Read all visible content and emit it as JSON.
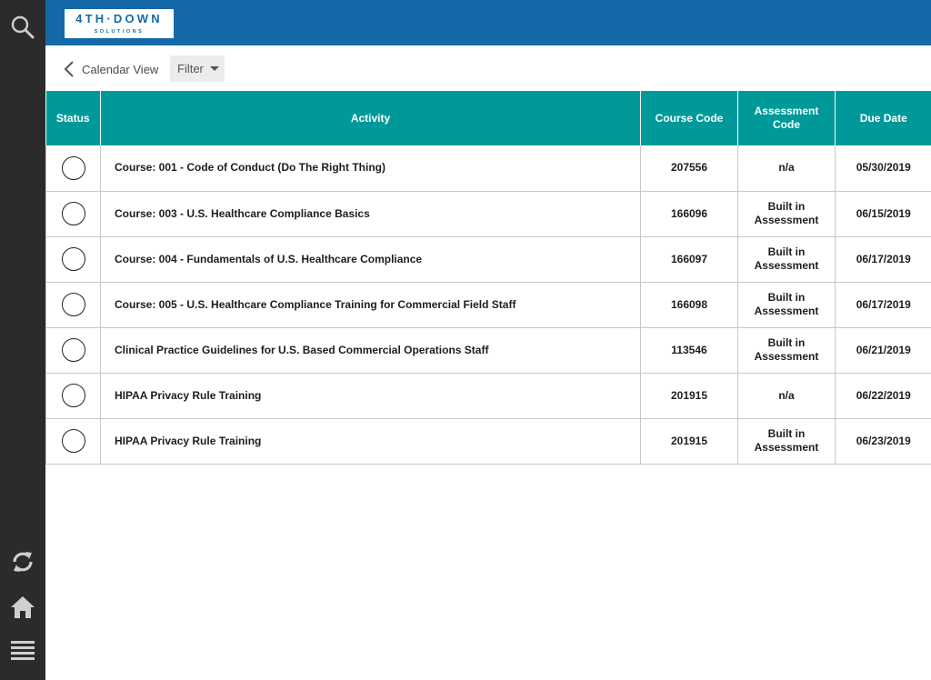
{
  "brand": {
    "logo_main": "4TH·DOWN",
    "logo_sub": "SOLUTIONS",
    "colors": {
      "header": "#1569a8",
      "table_header": "#00999a",
      "rail": "#2b2b2b"
    }
  },
  "rail": {
    "icons": [
      "search-icon",
      "refresh-icon",
      "home-icon",
      "menu-icon"
    ]
  },
  "toolbar": {
    "back_label": "Calendar View",
    "filter_label": "Filter"
  },
  "table": {
    "columns": [
      "Status",
      "Activity",
      "Course Code",
      "Assessment Code",
      "Due Date"
    ],
    "rows": [
      {
        "activity": "Course: 001 - Code of Conduct (Do The Right Thing)",
        "course_code": "207556",
        "assessment_code": "n/a",
        "due_date": "05/30/2019"
      },
      {
        "activity": "Course: 003 - U.S. Healthcare Compliance Basics",
        "course_code": "166096",
        "assessment_code": "Built in Assessment",
        "due_date": "06/15/2019"
      },
      {
        "activity": "Course: 004 - Fundamentals of U.S. Healthcare Compliance",
        "course_code": "166097",
        "assessment_code": "Built in Assessment",
        "due_date": "06/17/2019"
      },
      {
        "activity": "Course: 005 - U.S. Healthcare Compliance Training for Commercial Field Staff",
        "course_code": "166098",
        "assessment_code": "Built in Assessment",
        "due_date": "06/17/2019"
      },
      {
        "activity": "Clinical Practice Guidelines for U.S. Based Commercial Operations Staff",
        "course_code": "113546",
        "assessment_code": "Built in Assessment",
        "due_date": "06/21/2019"
      },
      {
        "activity": "HIPAA Privacy Rule Training",
        "course_code": "201915",
        "assessment_code": "n/a",
        "due_date": "06/22/2019"
      },
      {
        "activity": "HIPAA Privacy Rule Training",
        "course_code": "201915",
        "assessment_code": "Built in Assessment",
        "due_date": "06/23/2019"
      }
    ]
  }
}
